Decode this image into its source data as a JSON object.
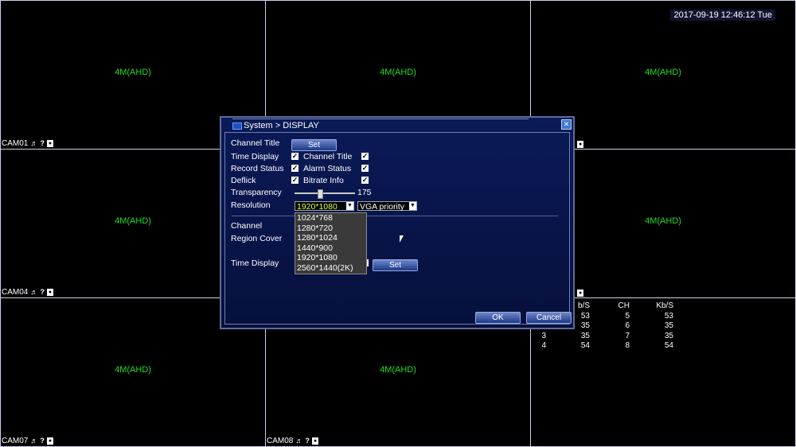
{
  "clock": "2017-09-19 12:46:12 Tue",
  "cells": [
    {
      "resolution": "4M(AHD)",
      "cam": ""
    },
    {
      "resolution": "4M(AHD)",
      "cam": ""
    },
    {
      "resolution": "4M(AHD)",
      "cam": ""
    },
    {
      "resolution": "",
      "cam": "CAM01"
    },
    {
      "resolution": "4M(AHD)",
      "cam": ""
    },
    {
      "resolution": "4M(AHD)",
      "cam": ""
    },
    {
      "resolution": "4M(AHD)",
      "cam": "CAM04"
    },
    {
      "resolution": "4M(AHD)",
      "cam": "CAM08"
    },
    {
      "resolution": "4M(AHD)",
      "cam": "CAM07"
    }
  ],
  "cam_labels": {
    "cam01": "CAM01",
    "cam04": "CAM04",
    "cam07": "CAM07",
    "cam08": "CAM08"
  },
  "res_label": "4M(AHD)",
  "stats": {
    "headers": [
      "",
      "b/S",
      "CH",
      "Kb/S"
    ],
    "rows": [
      [
        "",
        "53",
        "5",
        "53"
      ],
      [
        "",
        "35",
        "6",
        "35"
      ],
      [
        "3",
        "35",
        "7",
        "35"
      ],
      [
        "4",
        "54",
        "8",
        "54"
      ]
    ]
  },
  "dialog": {
    "title": "System > DISPLAY",
    "channel_title": "Channel Title",
    "set": "Set",
    "time_display": "Time Display",
    "channel_title2": "Channel Title",
    "record_status": "Record Status",
    "alarm_status": "Alarm Status",
    "deflick": "Deflick",
    "bitrate_info": "Bitrate Info",
    "transparency": "Transparency",
    "transparency_value": "175",
    "transparency_level": 0.38,
    "resolution": "Resolution",
    "resolution_value": "1920*1080",
    "priority_value": "VGA priority",
    "channel": "Channel",
    "region_cover": "Region Cover",
    "time_display2": "Time Display",
    "set2": "Set",
    "ok": "OK",
    "cancel": "Cancel",
    "resolution_options": [
      "1024*768",
      "1280*720",
      "1280*1024",
      "1440*900",
      "1920*1080",
      "2560*1440(2K)"
    ]
  },
  "colors": {
    "accent": "#22dd22",
    "selected_text": "#d8ff40"
  }
}
